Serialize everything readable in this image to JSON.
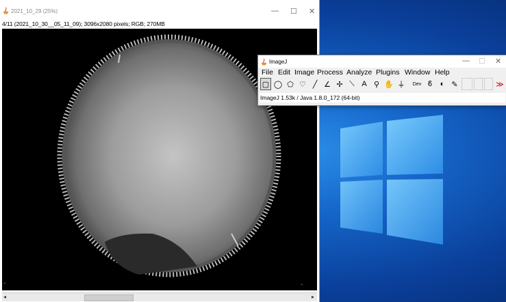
{
  "image_window": {
    "title": "2021_10_29 (25%)",
    "info": "4/11 (2021_10_30__05_11_09); 3096x2080 pixels; RGB; 270MB",
    "controls": {
      "minimize": "—",
      "maximize": "☐",
      "close": "✕"
    },
    "scroll_left": "◂",
    "scroll_right": "▸",
    "colors": {
      "background": "#000000",
      "sky_glow": "#c8c8c8"
    }
  },
  "imagej_window": {
    "title": "ImageJ",
    "controls": {
      "minimize": "—",
      "maximize": "☐",
      "close": "✕"
    },
    "menu": [
      "File",
      "Edit",
      "Image",
      "Process",
      "Analyze",
      "Plugins",
      "Window",
      "Help"
    ],
    "tools": [
      {
        "name": "rectangle-tool",
        "glyph": "▢",
        "selected": true
      },
      {
        "name": "oval-tool",
        "glyph": "◯"
      },
      {
        "name": "polygon-tool",
        "glyph": "⬠"
      },
      {
        "name": "freehand-tool",
        "glyph": "♡"
      },
      {
        "name": "line-tool",
        "glyph": "╱"
      },
      {
        "name": "angle-tool",
        "glyph": "∠"
      },
      {
        "name": "point-tool",
        "glyph": "✢"
      },
      {
        "name": "wand-tool",
        "glyph": "⟍"
      },
      {
        "name": "text-tool",
        "glyph": "A"
      },
      {
        "name": "magnifier-tool",
        "glyph": "⚲"
      },
      {
        "name": "hand-tool",
        "glyph": "✋"
      },
      {
        "name": "dropper-tool",
        "glyph": "⏚"
      },
      {
        "name": "dev-tool",
        "glyph": "Dev"
      },
      {
        "name": "brush-tool",
        "glyph": "ϐ"
      },
      {
        "name": "flood-fill-tool",
        "glyph": "◐"
      },
      {
        "name": "pencil-tool",
        "glyph": "✎"
      },
      {
        "name": "more-tools",
        "glyph": "≫",
        "red": true
      }
    ],
    "status": "ImageJ 1.53k / Java 1.8.0_172 (64-bit)"
  },
  "desktop": {
    "colors": {
      "accent": "#1565c8",
      "logo": "#4fb2f5"
    }
  }
}
